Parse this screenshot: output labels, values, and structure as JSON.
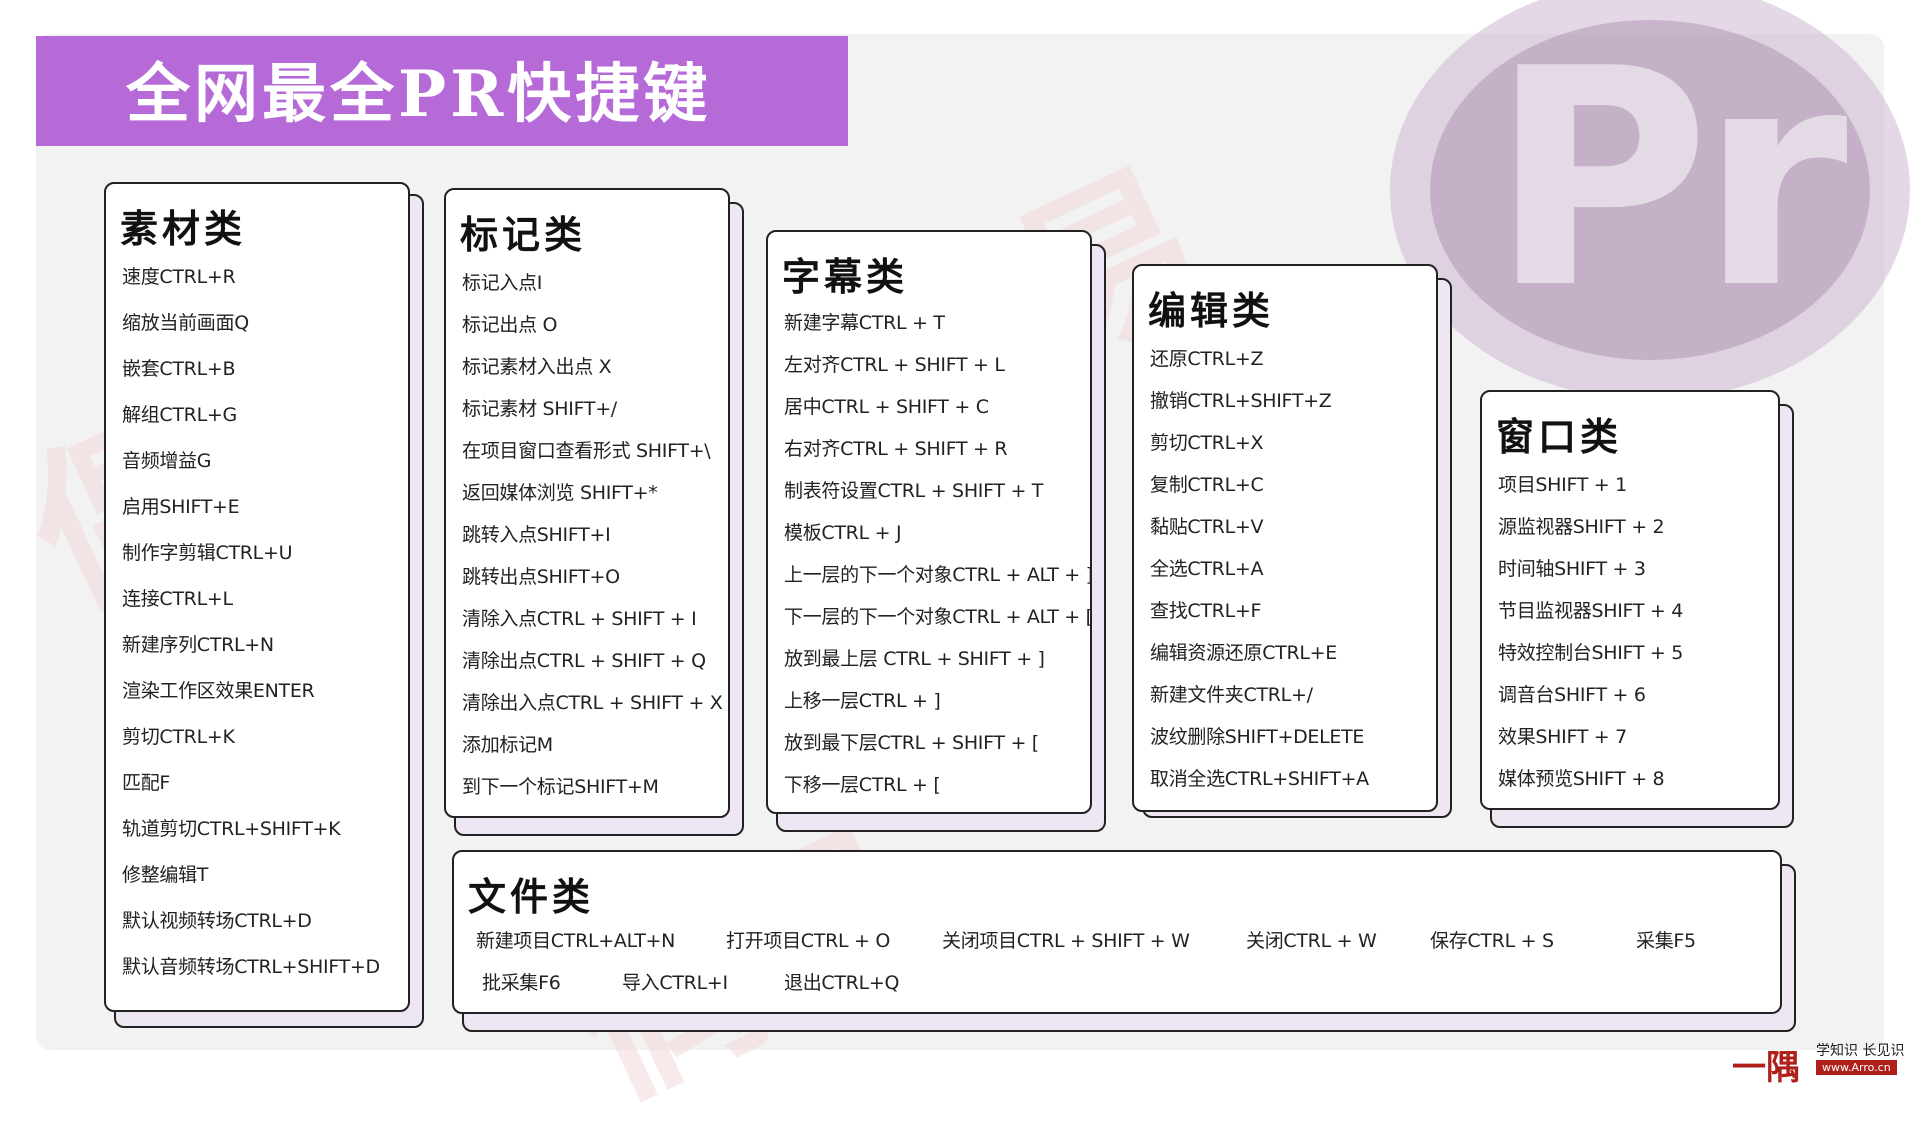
{
  "title": "全网最全PR快捷键",
  "logo_text": "Pr",
  "watermark_text": "偶易",
  "accent_color": "#b66ad8",
  "sections": {
    "material": {
      "heading": "素材类",
      "items": [
        "速度CTRL+R",
        "缩放当前画面Q",
        "嵌套CTRL+B",
        "解组CTRL+G",
        "音频增益G",
        "启用SHIFT+E",
        "制作字剪辑CTRL+U",
        "连接CTRL+L",
        "新建序列CTRL+N",
        "渲染工作区效果ENTER",
        "剪切CTRL+K",
        "匹配F",
        "轨道剪切CTRL+SHIFT+K",
        "修整编辑T",
        "默认视频转场CTRL+D",
        "默认音频转场CTRL+SHIFT+D"
      ]
    },
    "marker": {
      "heading": "标记类",
      "items": [
        "标记入点I",
        "标记出点 O",
        "标记素材入出点 X",
        "标记素材 SHIFT+/",
        "在项目窗口查看形式 SHIFT+\\",
        "返回媒体浏览 SHIFT+*",
        "跳转入点SHIFT+I",
        "跳转出点SHIFT+O",
        "清除入点CTRL + SHIFT + I",
        "清除出点CTRL + SHIFT + Q",
        "清除出入点CTRL + SHIFT + X",
        "添加标记M",
        "到下一个标记SHIFT+M"
      ]
    },
    "subtitle": {
      "heading": "字幕类",
      "items": [
        "新建字幕CTRL + T",
        "左对齐CTRL + SHIFT + L",
        "居中CTRL + SHIFT + C",
        "右对齐CTRL + SHIFT + R",
        "制表符设置CTRL + SHIFT + T",
        "模板CTRL + J",
        "上一层的下一个对象CTRL + ALT + ]",
        "下一层的下一个对象CTRL + ALT + [",
        "放到最上层 CTRL + SHIFT + ]",
        "上移一层CTRL + ]",
        "放到最下层CTRL + SHIFT + [",
        "下移一层CTRL + ["
      ]
    },
    "edit": {
      "heading": "编辑类",
      "items": [
        "还原CTRL+Z",
        "撤销CTRL+SHIFT+Z",
        "剪切CTRL+X",
        "复制CTRL+C",
        "黏贴CTRL+V",
        "全选CTRL+A",
        "查找CTRL+F",
        "编辑资源还原CTRL+E",
        "新建文件夹CTRL+/",
        "波纹删除SHIFT+DELETE",
        "取消全选CTRL+SHIFT+A"
      ]
    },
    "window": {
      "heading": "窗口类",
      "items": [
        "项目SHIFT + 1",
        "源监视器SHIFT + 2",
        "时间轴SHIFT + 3",
        "节目监视器SHIFT + 4",
        "特效控制台SHIFT + 5",
        "调音台SHIFT + 6",
        "效果SHIFT + 7",
        "媒体预览SHIFT + 8"
      ]
    },
    "file": {
      "heading": "文件类",
      "items": [
        "新建项目CTRL+ALT+N",
        "打开项目CTRL + O",
        "关闭项目CTRL + SHIFT + W",
        "关闭CTRL + W",
        "保存CTRL + S",
        "采集F5",
        "批采集F6",
        "导入CTRL+I",
        "退出CTRL+Q"
      ]
    }
  },
  "brand": {
    "mark": "一隅",
    "slogan": "学知识 长见识",
    "url": "www.Arro.cn"
  }
}
